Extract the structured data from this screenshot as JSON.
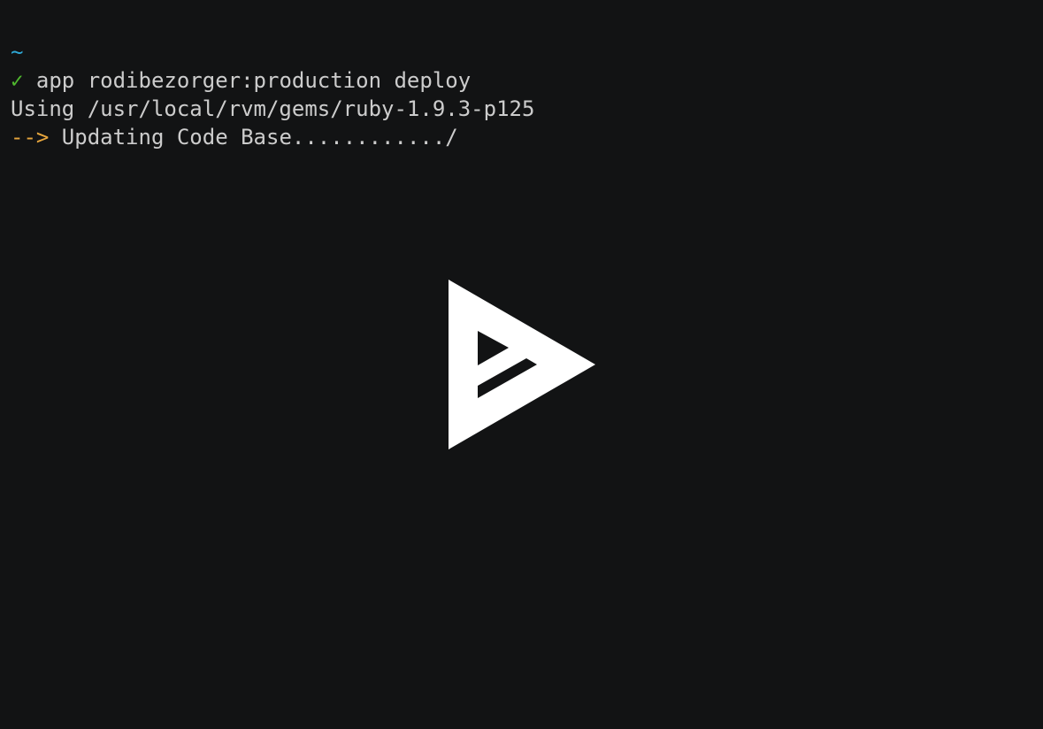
{
  "terminal": {
    "lines": [
      {
        "prefix": "~",
        "text": ""
      },
      {
        "prefix": "✓",
        "text": " app rodibezorger:production deploy"
      },
      {
        "prefix": "",
        "text": "Using /usr/local/rvm/gems/ruby-1.9.3-p125"
      },
      {
        "prefix": "-->",
        "text": " Updating Code Base............/"
      }
    ]
  },
  "player": {
    "play_icon": "asciinema-play-icon"
  },
  "colors": {
    "background": "#121314",
    "text": "#cccccc",
    "prompt_tilde": "#2ea8d6",
    "success_check": "#4fb82e",
    "progress_arrow": "#e7a63d",
    "play_icon": "#ffffff"
  }
}
